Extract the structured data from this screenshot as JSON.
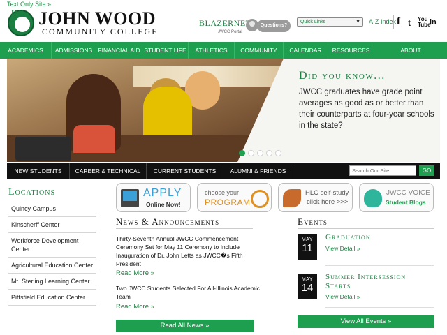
{
  "top": {
    "text_only": "Text Only Site »"
  },
  "header": {
    "logo_mark": "JW",
    "college_name": "JOHN WOOD",
    "college_sub": "COMMUNITY COLLEGE",
    "blazernet": "BLAZERNET",
    "portal": "JWCC Portal",
    "questions": "Questions?",
    "quick_links": "Quick Links",
    "az_index": "A-Z Index",
    "social": {
      "facebook": "f",
      "twitter": "t",
      "youtube": "You Tube",
      "linkedin": "in"
    }
  },
  "nav": {
    "items": [
      "ACADEMICS",
      "ADMISSIONS",
      "FINANCIAL AID",
      "STUDENT LIFE",
      "ATHLETICS",
      "COMMUNITY",
      "CALENDAR",
      "RESOURCES",
      "ABOUT"
    ]
  },
  "hero": {
    "title": "Did you know...",
    "text": "JWCC graduates have grade point averages as good as or better than their counterparts at four-year schools in the state?",
    "active_slide": 1,
    "slide_count": 5
  },
  "subnav": {
    "items": [
      "NEW STUDENTS",
      "CAREER & TECHNICAL",
      "CURRENT STUDENTS",
      "ALUMNI & FRIENDS"
    ],
    "search_placeholder": "Search Our Site",
    "go": "GO"
  },
  "locations": {
    "title": "Locations",
    "items": [
      "Quincy Campus",
      "Kinscherff Center",
      "Workforce Development Center",
      "Agricultural Education Center",
      "Mt. Sterling Learning Center",
      "Pittsfield Education Center"
    ]
  },
  "promos": {
    "apply": {
      "l1": "APPLY",
      "l2": "Online Now!"
    },
    "program": {
      "l1": "choose your",
      "l2": "PROGRAM"
    },
    "hlc": {
      "l1": "HLC self-study",
      "l2": "click here >>>"
    },
    "voice": {
      "l1": "JWCC VOICE",
      "l2": "Student Blogs"
    }
  },
  "news": {
    "title": "News & Announcements",
    "items": [
      {
        "text": "Thirty-Seventh Annual JWCC Commencement Ceremony Set for May 11 Ceremony to Include Inauguration of Dr. John Letts as JWCC�s Fifth President",
        "more": "Read More »"
      },
      {
        "text": "Two JWCC Students Selected For All-Illinois Academic Team",
        "more": "Read More »"
      }
    ],
    "read_all": "Read All News »"
  },
  "events": {
    "title": "Events",
    "items": [
      {
        "month": "MAY",
        "day": "11",
        "title": "Graduation",
        "link": "View Detail »"
      },
      {
        "month": "MAY",
        "day": "14",
        "title": "Summer Intersession Starts",
        "link": "View Detail »"
      }
    ],
    "view_all": "View All Events »"
  },
  "colors": {
    "accent": "#1e9e4f",
    "dark": "#111111"
  }
}
